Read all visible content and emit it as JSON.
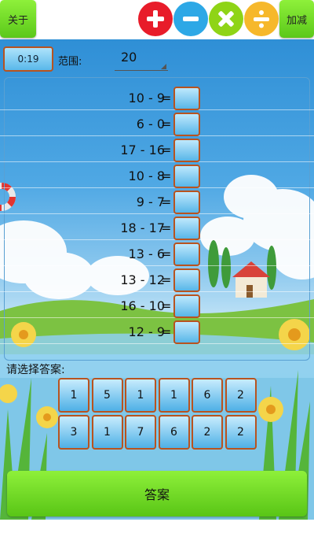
{
  "header": {
    "about_label": "关于",
    "mode_label": "加减",
    "operators": [
      {
        "icon": "plus-icon",
        "color": "#e81c2a"
      },
      {
        "icon": "minus-icon",
        "color": "#2da8e6"
      },
      {
        "icon": "multiply-icon",
        "color": "#8fd416"
      },
      {
        "icon": "divide-icon",
        "color": "#f6b82b"
      }
    ]
  },
  "controls": {
    "timer": "0:19",
    "range_label": "范围:",
    "range_value": "20"
  },
  "questions": [
    {
      "expr": "10 - 9",
      "eq": "="
    },
    {
      "expr": "6 - 0",
      "eq": "="
    },
    {
      "expr": "17 - 16",
      "eq": "="
    },
    {
      "expr": "10 - 8",
      "eq": "="
    },
    {
      "expr": "9 - 7",
      "eq": "="
    },
    {
      "expr": "18 - 17",
      "eq": "="
    },
    {
      "expr": "13 - 6",
      "eq": "="
    },
    {
      "expr": "13 - 12",
      "eq": "="
    },
    {
      "expr": "16 - 10",
      "eq": "="
    },
    {
      "expr": "12 - 9",
      "eq": "="
    }
  ],
  "answer_prompt": "请选择答案:",
  "answer_choices": [
    [
      "1",
      "5",
      "1",
      "1",
      "6",
      "2"
    ],
    [
      "3",
      "1",
      "7",
      "6",
      "2",
      "2"
    ]
  ],
  "answer_button_label": "答案",
  "colors": {
    "accent_green": "#6fdc22",
    "tile_border": "#b8531f",
    "tile_fill": "#58b6e8"
  }
}
